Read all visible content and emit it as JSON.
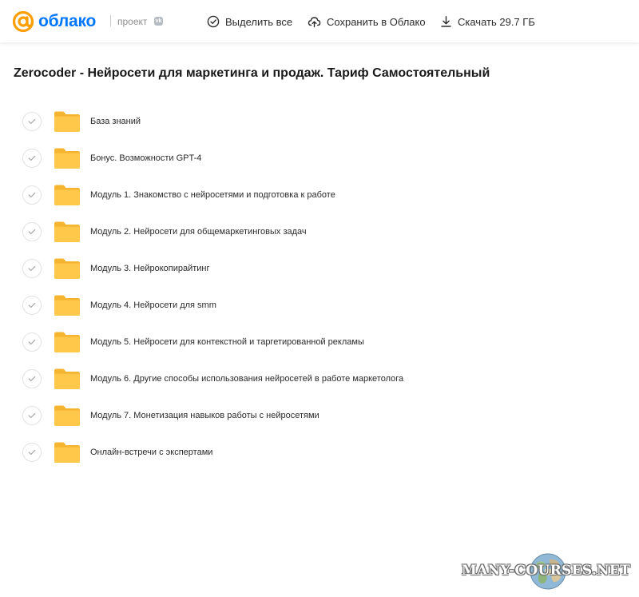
{
  "header": {
    "logo_text": "облако",
    "project_label": "проект",
    "vk_badge": "vk",
    "select_all_label": "Выделить все",
    "save_label": "Сохранить в Облако",
    "download_label": "Скачать 29.7 ГБ",
    "select_all_icon": "check-circle-icon",
    "save_icon": "cloud-upload-icon",
    "download_icon": "download-icon"
  },
  "page": {
    "title": "Zerocoder - Нейросети для маркетинга и продаж. Тариф Самостоятельный"
  },
  "files": [
    {
      "name": "База знаний",
      "type": "folder"
    },
    {
      "name": "Бонус. Возможности GPT-4",
      "type": "folder"
    },
    {
      "name": "Модуль 1. Знакомство с нейросетями и подготовка к работе",
      "type": "folder"
    },
    {
      "name": "Модуль 2. Нейросети для общемаркетинговых задач",
      "type": "folder"
    },
    {
      "name": "Модуль 3. Нейрокопирайтинг",
      "type": "folder"
    },
    {
      "name": "Модуль 4. Нейросети для smm",
      "type": "folder"
    },
    {
      "name": "Модуль 5. Нейросети для контекстной и таргетированной рекламы",
      "type": "folder"
    },
    {
      "name": "Модуль 6. Другие способы использования нейросетей в работе маркетолога",
      "type": "folder"
    },
    {
      "name": "Модуль 7. Монетизация навыков работы с нейросетями",
      "type": "folder"
    },
    {
      "name": "Онлайн-встречи с экспертами",
      "type": "folder"
    }
  ],
  "watermark": {
    "text": "MANY-COURSES.NET"
  },
  "colors": {
    "brand": "#0077ff",
    "logo_accent": "#ff9e00",
    "folder": "#ffc84a",
    "folder_dark": "#f5b531"
  }
}
